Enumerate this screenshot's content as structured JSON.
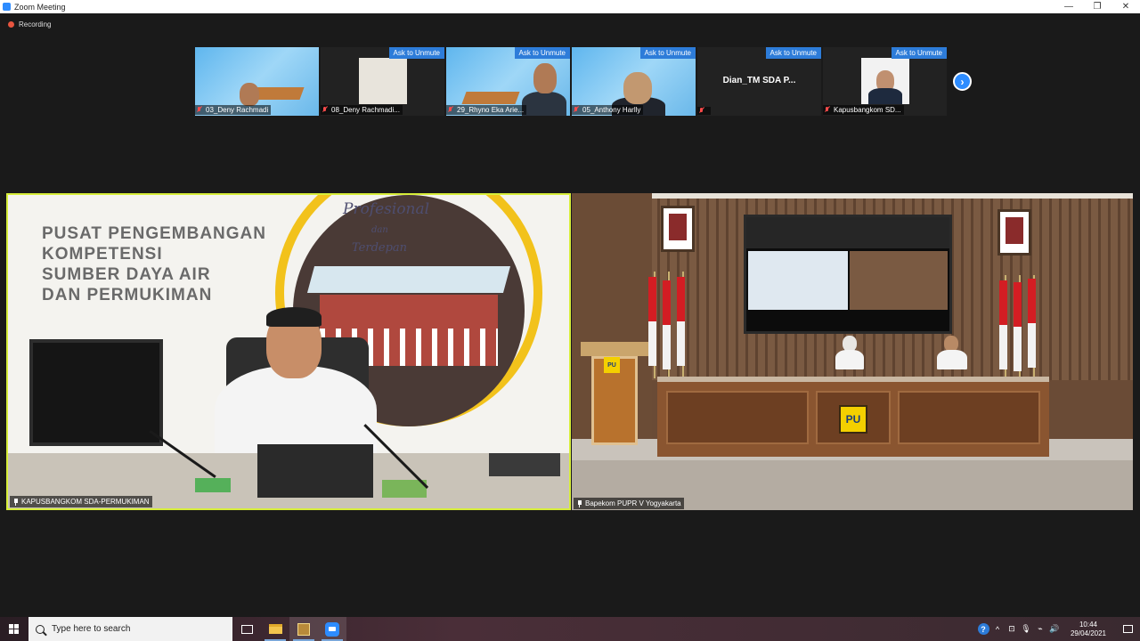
{
  "window": {
    "title": "Zoom Meeting",
    "minimize": "—",
    "restore": "❐",
    "close": "✕"
  },
  "recording": {
    "label": "Recording"
  },
  "gallery": {
    "next_arrow": "›",
    "thumbs": [
      {
        "name": "03_Deny Rachmadi",
        "ask": ""
      },
      {
        "name": "08_Deny Rachmadi...",
        "ask": "Ask to Unmute"
      },
      {
        "name": "29_Rhyno Eka Arie...",
        "ask": "Ask to Unmute"
      },
      {
        "name": "05_Anthony Harlly",
        "ask": "Ask to Unmute"
      },
      {
        "name": "",
        "ask": "Ask to Unmute",
        "center_name": "Dian_TM SDA P..."
      },
      {
        "name": "Kapusbangkom SD...",
        "ask": "Ask to Unmute"
      }
    ]
  },
  "main_tiles": {
    "left": {
      "label": "KAPUSBANGKOM SDA-PERMUKIMAN",
      "headline": [
        "PUSAT PENGEMBANGAN",
        "KOMPETENSI",
        "SUMBER DAYA AIR",
        "DAN PERMUKIMAN"
      ],
      "tagline_1": "Profesional",
      "tagline_dan": "dan",
      "tagline_2": "Terdepan"
    },
    "right": {
      "label": "Bapekom PUPR V Yogyakarta",
      "logo_text": "PU"
    }
  },
  "taskbar": {
    "search_placeholder": "Type here to search",
    "time": "10:44",
    "date": "29/04/2021",
    "help": "?",
    "tray_glyphs": [
      "^",
      "⊡",
      "🎙",
      "⌁",
      "🔊"
    ]
  },
  "colors": {
    "zoom_blue": "#2d8cff",
    "active_speaker_border": "#d7ee3a",
    "recording_dot": "#e8553f"
  }
}
